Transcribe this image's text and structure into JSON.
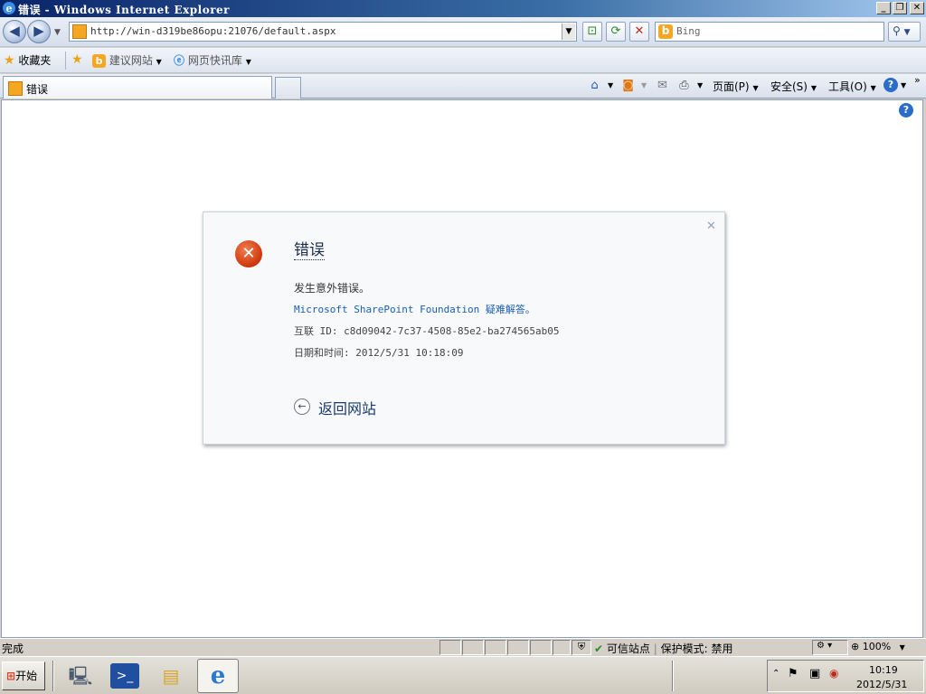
{
  "window": {
    "title": "错误 - Windows Internet Explorer",
    "minimize": "_",
    "restore": "❐",
    "close": "✕"
  },
  "address_bar": {
    "url": "http://win-d319be86opu:21076/default.aspx",
    "search_placeholder": "Bing"
  },
  "favorites_bar": {
    "favorites": "收藏夹",
    "suggested_sites": "建议网站",
    "web_slice_gallery": "网页快讯库"
  },
  "tabs": [
    {
      "label": "错误"
    }
  ],
  "command_bar": {
    "page": "页面(P)",
    "safety": "安全(S)",
    "tools": "工具(O)"
  },
  "error_dialog": {
    "title": "错误",
    "message": "发生意外错误。",
    "link": "Microsoft SharePoint Foundation 疑难解答。",
    "correlation_id": "互联 ID: c8d09042-7c37-4508-85e2-ba274565ab05",
    "datetime": "日期和时间: 2012/5/31 10:18:09",
    "back_label": "返回网站"
  },
  "status_bar": {
    "status_text": "完成",
    "zone": "可信站点",
    "protected_mode": "保护模式: 禁用",
    "zoom": "100%"
  },
  "taskbar": {
    "start_label": "开始",
    "clock_time": "10:19",
    "clock_date": "2012/5/31"
  },
  "icons": {
    "ie": "internet-explorer-icon",
    "error": "error-x-icon",
    "back_arrow": "back-arrow-icon"
  },
  "colors": {
    "error_red": "#d13a0f",
    "link_blue": "#1a5fb4",
    "title_bar": "#0a246a"
  }
}
